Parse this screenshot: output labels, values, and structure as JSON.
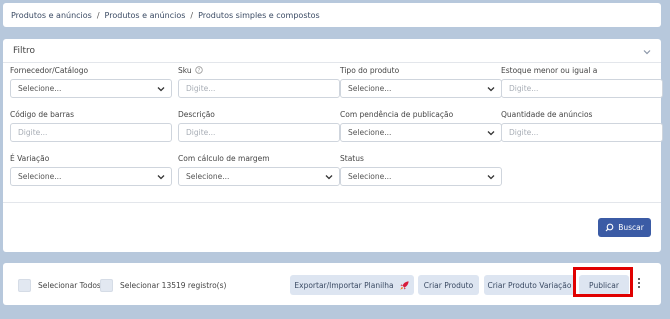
{
  "breadcrumb": [
    "Produtos e anúncios",
    "Produtos e anúncios",
    "Produtos simples e compostos"
  ],
  "filter": {
    "title": "Filtro",
    "fields": [
      {
        "label": "Fornecedor/Catálogo",
        "value": "Selecione...",
        "type": "select"
      },
      {
        "label": "Sku",
        "value": "Digite...",
        "type": "input",
        "info": true
      },
      {
        "label": "Tipo do produto",
        "value": "Selecione...",
        "type": "select"
      },
      {
        "label": "Estoque menor ou igual a",
        "value": "Digite...",
        "type": "input"
      },
      {
        "label": "Código de barras",
        "value": "Digite...",
        "type": "input"
      },
      {
        "label": "Descrição",
        "value": "Digite...",
        "type": "input"
      },
      {
        "label": "Com pendência de publicação",
        "value": "Selecione...",
        "type": "select"
      },
      {
        "label": "Quantidade de anúncios",
        "value": "Digite...",
        "type": "input"
      },
      {
        "label": "É Variação",
        "value": "Selecione...",
        "type": "select"
      },
      {
        "label": "Com cálculo de margem",
        "value": "Selecione...",
        "type": "select"
      },
      {
        "label": "Status",
        "value": "Selecione...",
        "type": "select"
      }
    ],
    "search_button": "Buscar"
  },
  "actions": {
    "select_all": "Selecionar Todos",
    "select_records": "Selecionar 13519 registro(s)",
    "export_import": "Exportar/Importar Planilha",
    "create_product": "Criar Produto",
    "create_variation": "Criar Produto Variação",
    "publish": "Publicar"
  },
  "colors": {
    "accent": "#3b5ba5",
    "highlight": "#e00000",
    "rocket": "#d81b3c"
  }
}
